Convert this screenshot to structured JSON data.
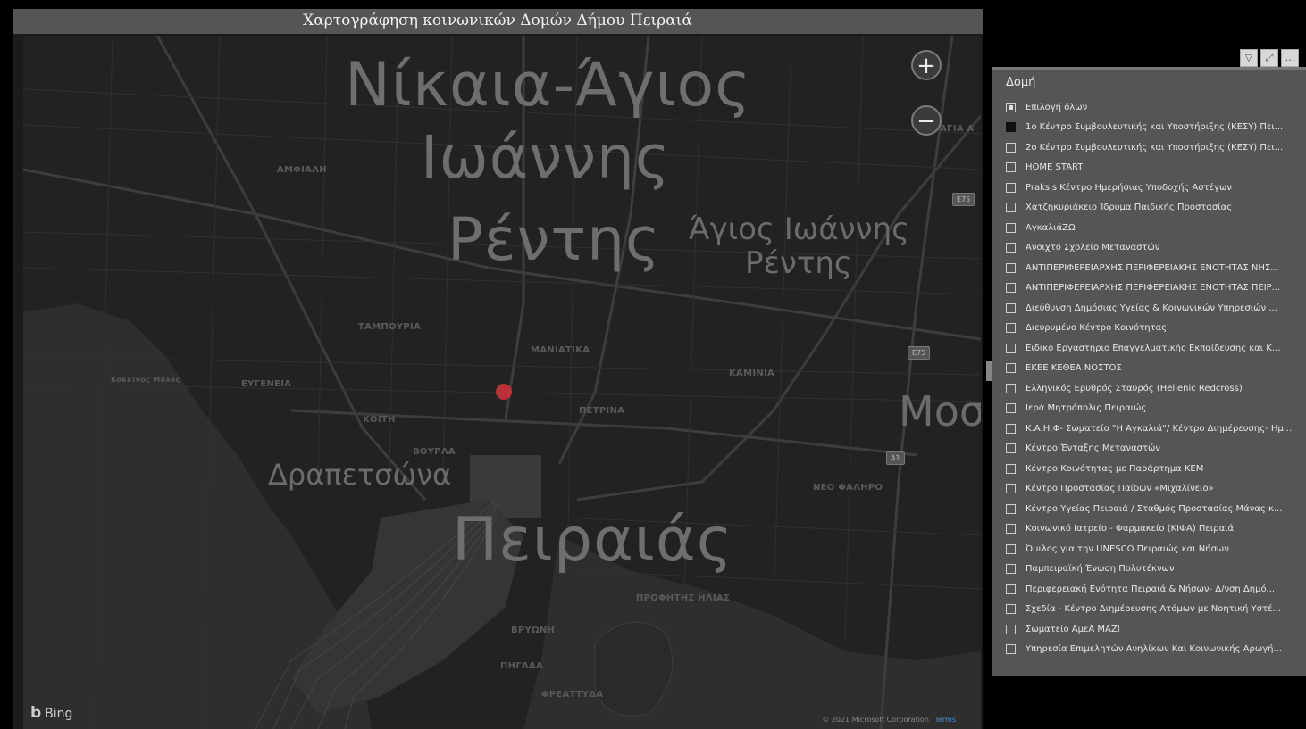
{
  "map": {
    "title": "Χαρτογράφηση κοινωνικών Δομών Δήμου Πειραιά",
    "zoom_in": "+",
    "zoom_out": "−",
    "labels_large": [
      "Νίκαια-Άγιος",
      "Ιωάννης",
      "Ρέντης",
      "Πειραιάς"
    ],
    "labels_medium": [
      "Άγιος Ιωάννης",
      "Ρέντης",
      "Δραπετσώνα",
      "Μοσ"
    ],
    "labels_small": {
      "amfiali": "ΑΜΦΙΑΛΗ",
      "agia": "ΑΓΙΑ Α",
      "tampouria": "ΤΑΜΠΟΥΡΙΑ",
      "maniatika": "ΜΑΝΙΑΤΙΚΑ",
      "kaminia": "ΚΑΜΙΝΙΑ",
      "evgeneia": "ΕΥΓΕΝΕΙΑ",
      "kokkinos_myl": "Κοκκινος Μύλος",
      "kastella": "ΚΟΙΤΗ",
      "vourla": "ΒΟΥΡΛΑ",
      "petrina": "ΠΕΤΡΙΝΑ",
      "neo_faliro": "ΝΕΟ ΦΑΛΗΡΟ",
      "profitis_ilias": "ΠΡΟΦΗΤΗΣ ΗΛΙΑΣ",
      "frathia": "ΠΗΓΑΔΑ",
      "kastrithia": "ΦΡΕΑΤΤΥΔΑ",
      "terpsithea": "ΒΡΥΩΝΗ"
    },
    "shields": [
      "E75",
      "E75",
      "A1"
    ],
    "bing_logo": "Bing",
    "copyright": "© 2021 Microsoft Corporation",
    "terms": "Terms"
  },
  "slicer": {
    "title": "Δομή",
    "toolbar_icons": [
      "filter-icon",
      "focus-mode-icon",
      "more-options-icon"
    ],
    "items": [
      {
        "label": "Επιλογή όλων",
        "state": "partial"
      },
      {
        "label": "1ο Κέντρο Συμβουλευτικής και Υποστήριξης (ΚΕΣΥ) Πει...",
        "state": "checked"
      },
      {
        "label": "2ο Κέντρο Συμβουλευτικής και Υποστήριξης (ΚΕΣΥ) Πει...",
        "state": "unchecked"
      },
      {
        "label": "HOME START",
        "state": "unchecked"
      },
      {
        "label": "Praksis Κέντρο Ημερήσιας Υποδοχής Αστέγων",
        "state": "unchecked"
      },
      {
        "label": "Χατζηκυριάκειο Ίδρυμα Παιδικής Προστασίας",
        "state": "unchecked"
      },
      {
        "label": "AγκαλιάZΩ",
        "state": "unchecked"
      },
      {
        "label": "Ανοιχτό Σχολείο Μεταναστών",
        "state": "unchecked"
      },
      {
        "label": "ΑΝΤΙΠΕΡΙΦΕΡΕΙΑΡΧΗΣ ΠΕΡΙΦΕΡΕΙΑΚΗΣ ΕΝΟΤΗΤΑΣ ΝΗΣ...",
        "state": "unchecked"
      },
      {
        "label": "ΑΝΤΙΠΕΡΙΦΕΡΕΙΑΡΧΗΣ ΠΕΡΙΦΕΡΕΙΑΚΗΣ ΕΝΟΤΗΤΑΣ ΠΕΙΡ...",
        "state": "unchecked"
      },
      {
        "label": "Διεύθυνση Δημόσιας Υγείας & Κοινωνικών Υπηρεσιών ...",
        "state": "unchecked"
      },
      {
        "label": "Διευρυμένο Κέντρο Κοινότητας",
        "state": "unchecked"
      },
      {
        "label": "Ειδικό Εργαστήριο Επαγγελματικής Εκπαίδευσης και Κ...",
        "state": "unchecked"
      },
      {
        "label": "ΕΚΕΕ ΚΕΘΕΑ ΝΟΣΤΟΣ",
        "state": "unchecked"
      },
      {
        "label": "Ελληνικός Ερυθρός Σταυρός (Hellenic Redcross)",
        "state": "unchecked"
      },
      {
        "label": "Ιερά Μητρόπολις Πειραιώς",
        "state": "unchecked"
      },
      {
        "label": "Κ.Α.Η.Φ- Σωματείο \"Η Αγκαλιά\"/ Κέντρο Διημέρευσης- Ημ...",
        "state": "unchecked"
      },
      {
        "label": "Κέντρο Ένταξης Μεταναστών",
        "state": "unchecked"
      },
      {
        "label": "Κέντρο Κοινότητας με Παράρτημα ΚΕΜ",
        "state": "unchecked"
      },
      {
        "label": "Κέντρο Προστασίας Παίδων «Μιχαλίνειο»",
        "state": "unchecked"
      },
      {
        "label": "Κέντρο Υγείας Πειραιά / Σταθμός Προστασίας Μάνας κ...",
        "state": "unchecked"
      },
      {
        "label": "Κοινωνικό Ιατρείο - Φαρμακείο (ΚΙΦΑ) Πειραιά",
        "state": "unchecked"
      },
      {
        "label": "Όμιλος για την UNESCO Πειραιώς και Νήσων",
        "state": "unchecked"
      },
      {
        "label": "Παμπειραϊκή Ένωση Πολυτέκνων",
        "state": "unchecked"
      },
      {
        "label": "Περιφερειακή Ενότητα Πειραιά & Νήσων- Δ/νση Δημό...",
        "state": "unchecked"
      },
      {
        "label": "Σχεδία - Κέντρο Διημέρευσης Ατόμων με Νοητική Υστέ...",
        "state": "unchecked"
      },
      {
        "label": "Σωματείο ΑμεΑ ΜΑΖΙ",
        "state": "unchecked"
      },
      {
        "label": "Υπηρεσία Επιμελητών Ανηλίκων Και Κοινωνικής Αρωγή...",
        "state": "unchecked"
      }
    ]
  },
  "colors": {
    "marker": "#e0353e",
    "map_bg": "#222222",
    "panel_bg": "#555555"
  }
}
